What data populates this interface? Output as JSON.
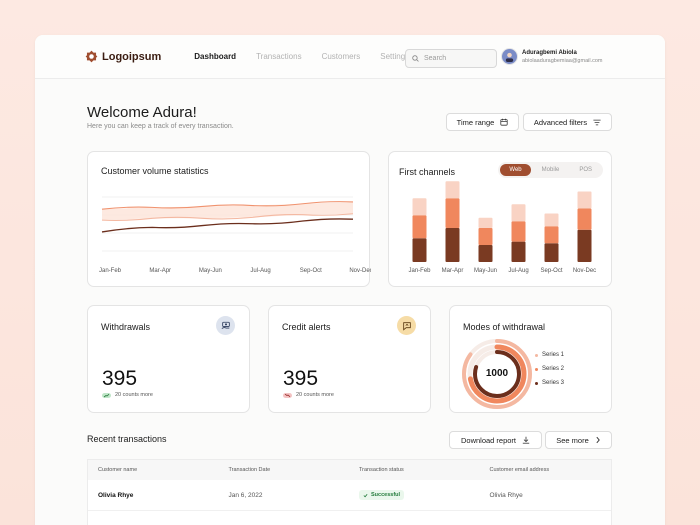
{
  "brand": {
    "name": "Logoipsum",
    "accent": "#a04e30"
  },
  "nav": {
    "items": [
      "Dashboard",
      "Transactions",
      "Customers",
      "Settings"
    ],
    "active": "Dashboard"
  },
  "search": {
    "placeholder": "Search"
  },
  "user": {
    "name": "Aduragbemi Abiola",
    "email": "abiolaaduragbemiaa@gmail.com"
  },
  "welcome": {
    "title": "Welcome Adura!",
    "subtitle": "Here you can keep a track of every transaction."
  },
  "filters": {
    "time_range": "Time range",
    "advanced": "Advanced filters"
  },
  "volume": {
    "title": "Customer volume statistics",
    "chart_data": {
      "type": "area",
      "x": [
        "Jan-Feb",
        "Mar-Apr",
        "May-Jun",
        "Jul-Aug",
        "Sep-Oct",
        "Nov-Dec"
      ],
      "series": [
        {
          "values": [
            80,
            82,
            83,
            84,
            86,
            88
          ],
          "color": "#f0926e"
        },
        {
          "values": [
            68,
            70,
            70,
            71,
            74,
            75
          ],
          "color": "#f4b8a1"
        },
        {
          "values": [
            55,
            60,
            62,
            64,
            67,
            69
          ],
          "color": "#6b2e1c"
        }
      ],
      "ylim": [
        0,
        100
      ]
    }
  },
  "channels": {
    "title": "First channels",
    "tabs": [
      "Web",
      "Mobile",
      "POS"
    ],
    "active_tab": "Web",
    "chart_data": {
      "type": "bar",
      "categories": [
        "Jan-Feb",
        "Mar-Apr",
        "May-Jun",
        "Jul-Aug",
        "Sep-Oct",
        "Nov-Dec"
      ],
      "series": [
        {
          "values": [
            28,
            40,
            20,
            24,
            22,
            38
          ],
          "color": "#7a3a22"
        },
        {
          "values": [
            27,
            35,
            20,
            24,
            20,
            25
          ],
          "color": "#f0875d"
        },
        {
          "values": [
            20,
            20,
            12,
            20,
            15,
            20
          ],
          "color": "#f9d3c4"
        }
      ],
      "ylim": [
        0,
        100
      ]
    }
  },
  "withdrawals": {
    "title": "Withdrawals",
    "value": "395",
    "note": "20 counts more",
    "trend": "up"
  },
  "credit_alerts": {
    "title": "Credit alerts",
    "value": "395",
    "note": "20 counts more",
    "trend": "down"
  },
  "modes": {
    "title": "Modes of withdrawal",
    "center": "1000",
    "chart_data": {
      "type": "pie",
      "series": [
        {
          "name": "Series 1",
          "value": 85,
          "color": "#f4b8a1"
        },
        {
          "name": "Series 2",
          "value": 72,
          "color": "#f0875d"
        },
        {
          "name": "Series 3",
          "value": 80,
          "color": "#6b2e1c"
        }
      ]
    }
  },
  "recent": {
    "title": "Recent transactions",
    "download": "Download report",
    "see_more": "See more",
    "columns": [
      "Customer name",
      "Transaction Date",
      "Transaction status",
      "Customer email address"
    ],
    "rows": [
      {
        "name": "Olivia Rhye",
        "date": "Jan 6, 2022",
        "status": "Successful",
        "email": "Olivia Rhye"
      }
    ]
  }
}
